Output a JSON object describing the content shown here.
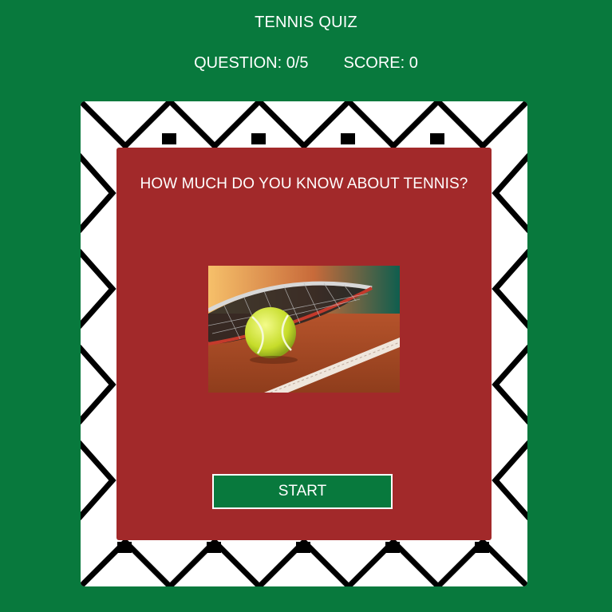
{
  "app": {
    "title": "TENNIS QUIZ"
  },
  "status": {
    "question_label": "QUESTION: 0/5",
    "score_label": "SCORE: 0"
  },
  "quiz_card": {
    "heading": "HOW MUCH DO YOU KNOW ABOUT TENNIS?",
    "image_alt": "tennis-ball-and-racket-on-clay-court",
    "start_label": "START"
  },
  "colors": {
    "background": "#08793d",
    "card": "#a2292a",
    "button": "#08793d",
    "fence_wire": "#000000",
    "fence_background": "#ffffff"
  }
}
